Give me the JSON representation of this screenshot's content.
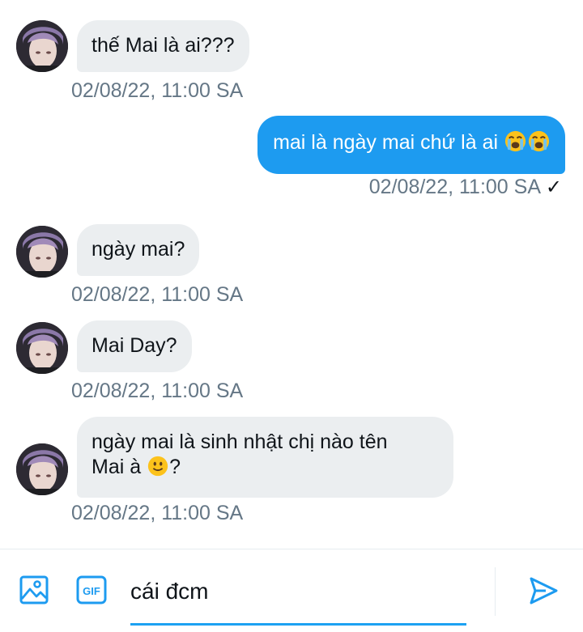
{
  "messages": [
    {
      "direction": "in",
      "text": "thế Mai là ai???",
      "timestamp": "02/08/22, 11:00 SA"
    },
    {
      "direction": "out",
      "text": "mai là ngày mai chứ là ai",
      "emoji": "loudly-crying-face",
      "timestamp": "02/08/22, 11:00 SA",
      "status": "✓"
    },
    {
      "direction": "in",
      "text": "ngày mai?",
      "timestamp": "02/08/22, 11:00 SA"
    },
    {
      "direction": "in",
      "text": "Mai Day?",
      "timestamp": "02/08/22, 11:00 SA"
    },
    {
      "direction": "in",
      "line1": "ngày mai là sinh nhật chị nào tên",
      "line2_prefix": "Mai à ",
      "emoji": "slightly-smiling-face",
      "line2_suffix": "?",
      "timestamp": "02/08/22, 11:00 SA"
    }
  ],
  "composer": {
    "value": "cái đcm",
    "image_icon": "image-icon",
    "gif_label": "GIF",
    "send_icon": "send-icon"
  },
  "colors": {
    "accent": "#1d9bf0",
    "incoming_bubble": "#ebeef0",
    "timestamp": "#657786"
  }
}
